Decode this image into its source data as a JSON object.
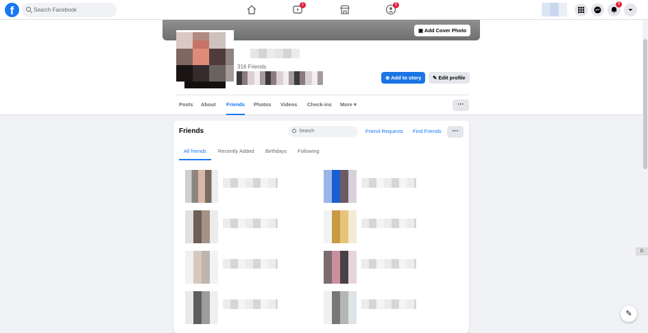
{
  "topbar": {
    "logo": "f",
    "search_placeholder": "Search Facebook",
    "badges": {
      "watch": "1",
      "groups": "5",
      "notifications": "9"
    }
  },
  "profile": {
    "cover_button": "Add Cover Photo",
    "friends_count": "316 Friends",
    "add_story_label": "Add to story",
    "edit_profile_label": "Edit profile",
    "tabs": [
      "Posts",
      "About",
      "Friends",
      "Photos",
      "Videos",
      "Check-ins",
      "More"
    ],
    "active_tab": "Friends",
    "dots": "···"
  },
  "friends_card": {
    "title": "Friends",
    "search_placeholder": "Search",
    "friend_requests": "Friend Requests",
    "find_friends": "Find Friends",
    "dots": "···",
    "subtabs": [
      "All friends",
      "Recently Added",
      "Birthdays",
      "Following"
    ],
    "active_subtab": "All friends"
  },
  "side_chip": "D",
  "colors": {
    "brand": "#1877f2",
    "badge": "#e41e3f",
    "button_blue": "#1b74e4"
  }
}
